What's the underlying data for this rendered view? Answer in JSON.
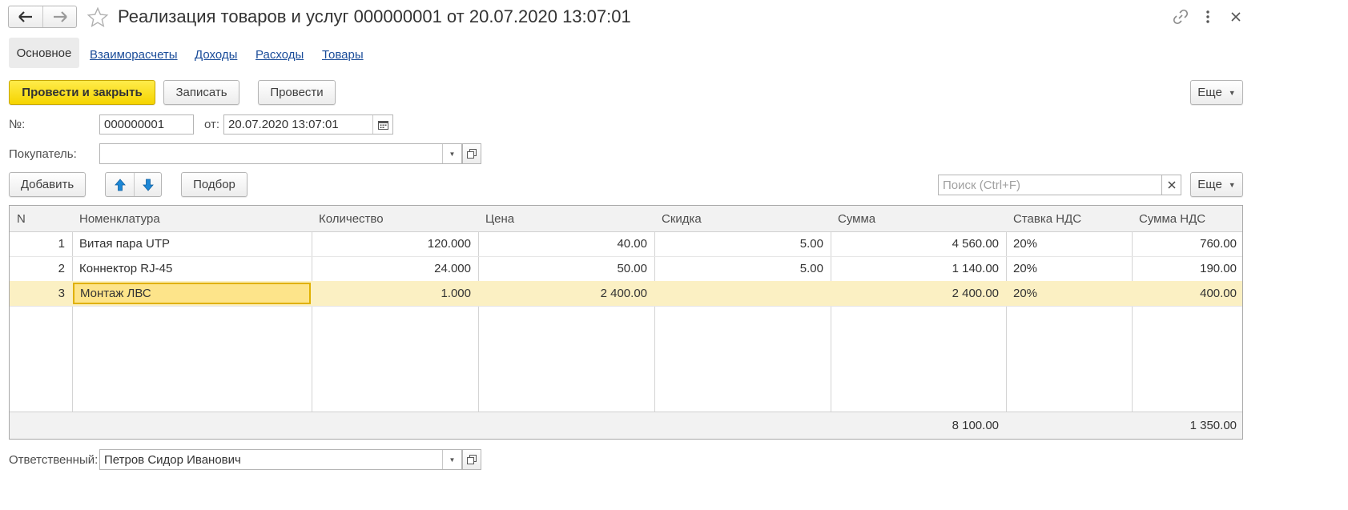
{
  "window": {
    "title": "Реализация товаров и услуг 000000001 от 20.07.2020 13:07:01"
  },
  "tabs": [
    "Основное",
    "Взаиморасчеты",
    "Доходы",
    "Расходы",
    "Товары"
  ],
  "toolbar": {
    "post_and_close": "Провести и закрыть",
    "save": "Записать",
    "post": "Провести",
    "more": "Еще"
  },
  "form": {
    "number_label": "№:",
    "number_value": "000000001",
    "date_label": "от:",
    "date_value": "20.07.2020 13:07:01",
    "buyer_label": "Покупатель:",
    "buyer_value": ""
  },
  "table_toolbar": {
    "add": "Добавить",
    "selection": "Подбор",
    "search_placeholder": "Поиск (Ctrl+F)",
    "more": "Еще"
  },
  "table": {
    "columns": [
      "N",
      "Номенклатура",
      "Количество",
      "Цена",
      "Скидка",
      "Сумма",
      "Ставка НДС",
      "Сумма НДС"
    ],
    "rows": [
      {
        "n": "1",
        "item": "Витая пара UTP",
        "qty": "120.000",
        "price": "40.00",
        "discount": "5.00",
        "sum": "4 560.00",
        "vat_rate": "20%",
        "vat_sum": "760.00"
      },
      {
        "n": "2",
        "item": "Коннектор RJ-45",
        "qty": "24.000",
        "price": "50.00",
        "discount": "5.00",
        "sum": "1 140.00",
        "vat_rate": "20%",
        "vat_sum": "190.00"
      },
      {
        "n": "3",
        "item": "Монтаж ЛВС",
        "qty": "1.000",
        "price": "2 400.00",
        "discount": "",
        "sum": "2 400.00",
        "vat_rate": "20%",
        "vat_sum": "400.00"
      }
    ],
    "totals": {
      "sum": "8 100.00",
      "vat_sum": "1 350.00"
    }
  },
  "footer": {
    "responsible_label": "Ответственный:",
    "responsible_value": "Петров Сидор Иванович"
  },
  "colors": {
    "primary_button": "#f5d400",
    "selected_row": "#fbf0c3",
    "selected_cell_border": "#e0b100",
    "link": "#1a4c99",
    "arrow_icon": "#1e88d6"
  },
  "icons": [
    "back-arrow-icon",
    "forward-arrow-icon",
    "star-icon",
    "link-icon",
    "more-vertical-icon",
    "close-icon",
    "calendar-icon",
    "dropdown-arrow-icon",
    "open-form-icon",
    "move-up-icon",
    "move-down-icon",
    "clear-icon"
  ]
}
